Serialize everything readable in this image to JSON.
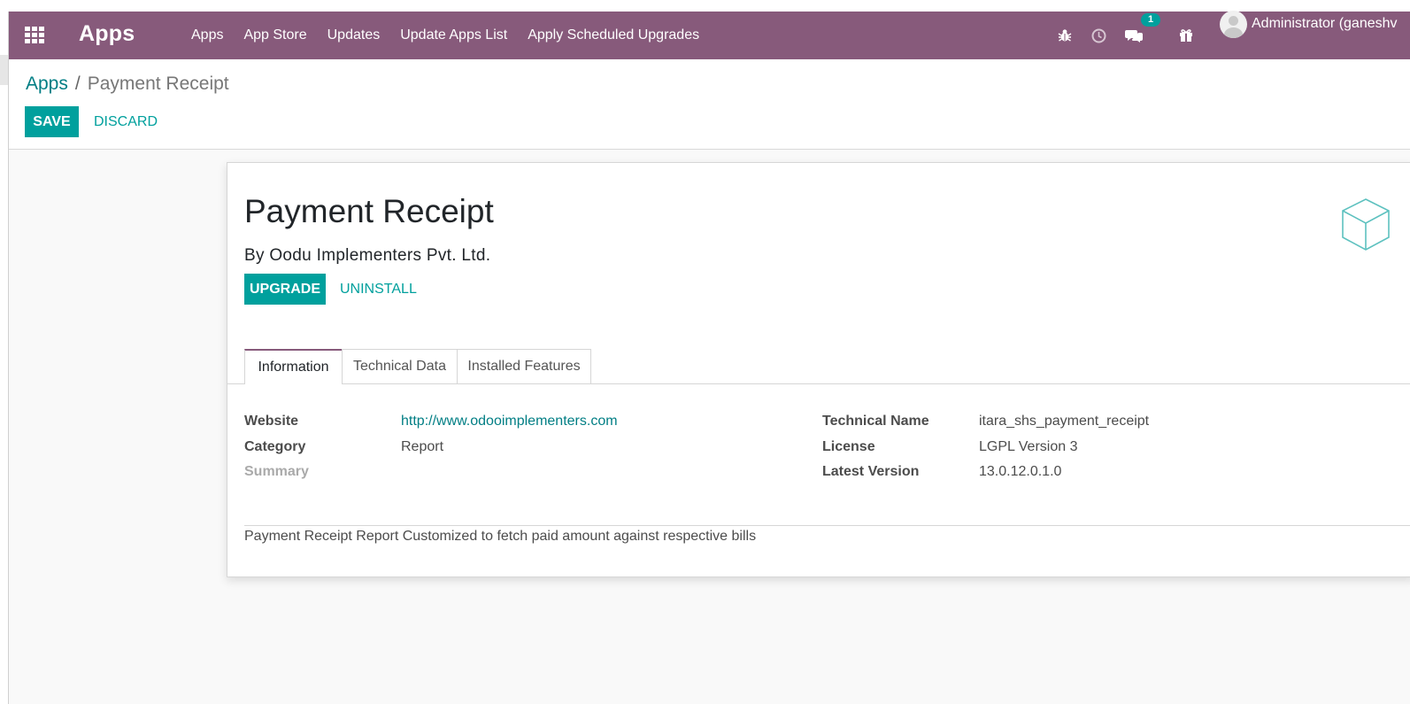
{
  "navbar": {
    "brand": "Apps",
    "menu": [
      "Apps",
      "App Store",
      "Updates",
      "Update Apps List",
      "Apply Scheduled Upgrades"
    ],
    "messages_badge": "1",
    "user_name": "Administrator (ganeshv",
    "icons": [
      "apps-grid-icon",
      "bug-icon",
      "clock-icon",
      "chat-icon",
      "gift-icon"
    ]
  },
  "breadcrumb": {
    "parent": "Apps",
    "separator": "/",
    "current": "Payment Receipt"
  },
  "actions": {
    "save": "SAVE",
    "discard": "DISCARD"
  },
  "module": {
    "name": "Payment Receipt",
    "author": "By Oodu Implementers Pvt. Ltd.",
    "upgrade": "UPGRADE",
    "uninstall": "UNINSTALL"
  },
  "tabs": [
    "Information",
    "Technical Data",
    "Installed Features"
  ],
  "info": {
    "website_label": "Website",
    "website": "http://www.odooimplementers.com",
    "category_label": "Category",
    "category": "Report",
    "summary_label": "Summary",
    "technical_name_label": "Technical Name",
    "technical_name": "itara_shs_payment_receipt",
    "license_label": "License",
    "license": "LGPL Version 3",
    "latest_version_label": "Latest Version",
    "latest_version": "13.0.12.0.1.0"
  },
  "description": "Payment Receipt Report Customized to fetch paid amount against respective bills",
  "colors": {
    "navbar": "#875a7b",
    "primary": "#00a09d",
    "link": "#017e84"
  }
}
